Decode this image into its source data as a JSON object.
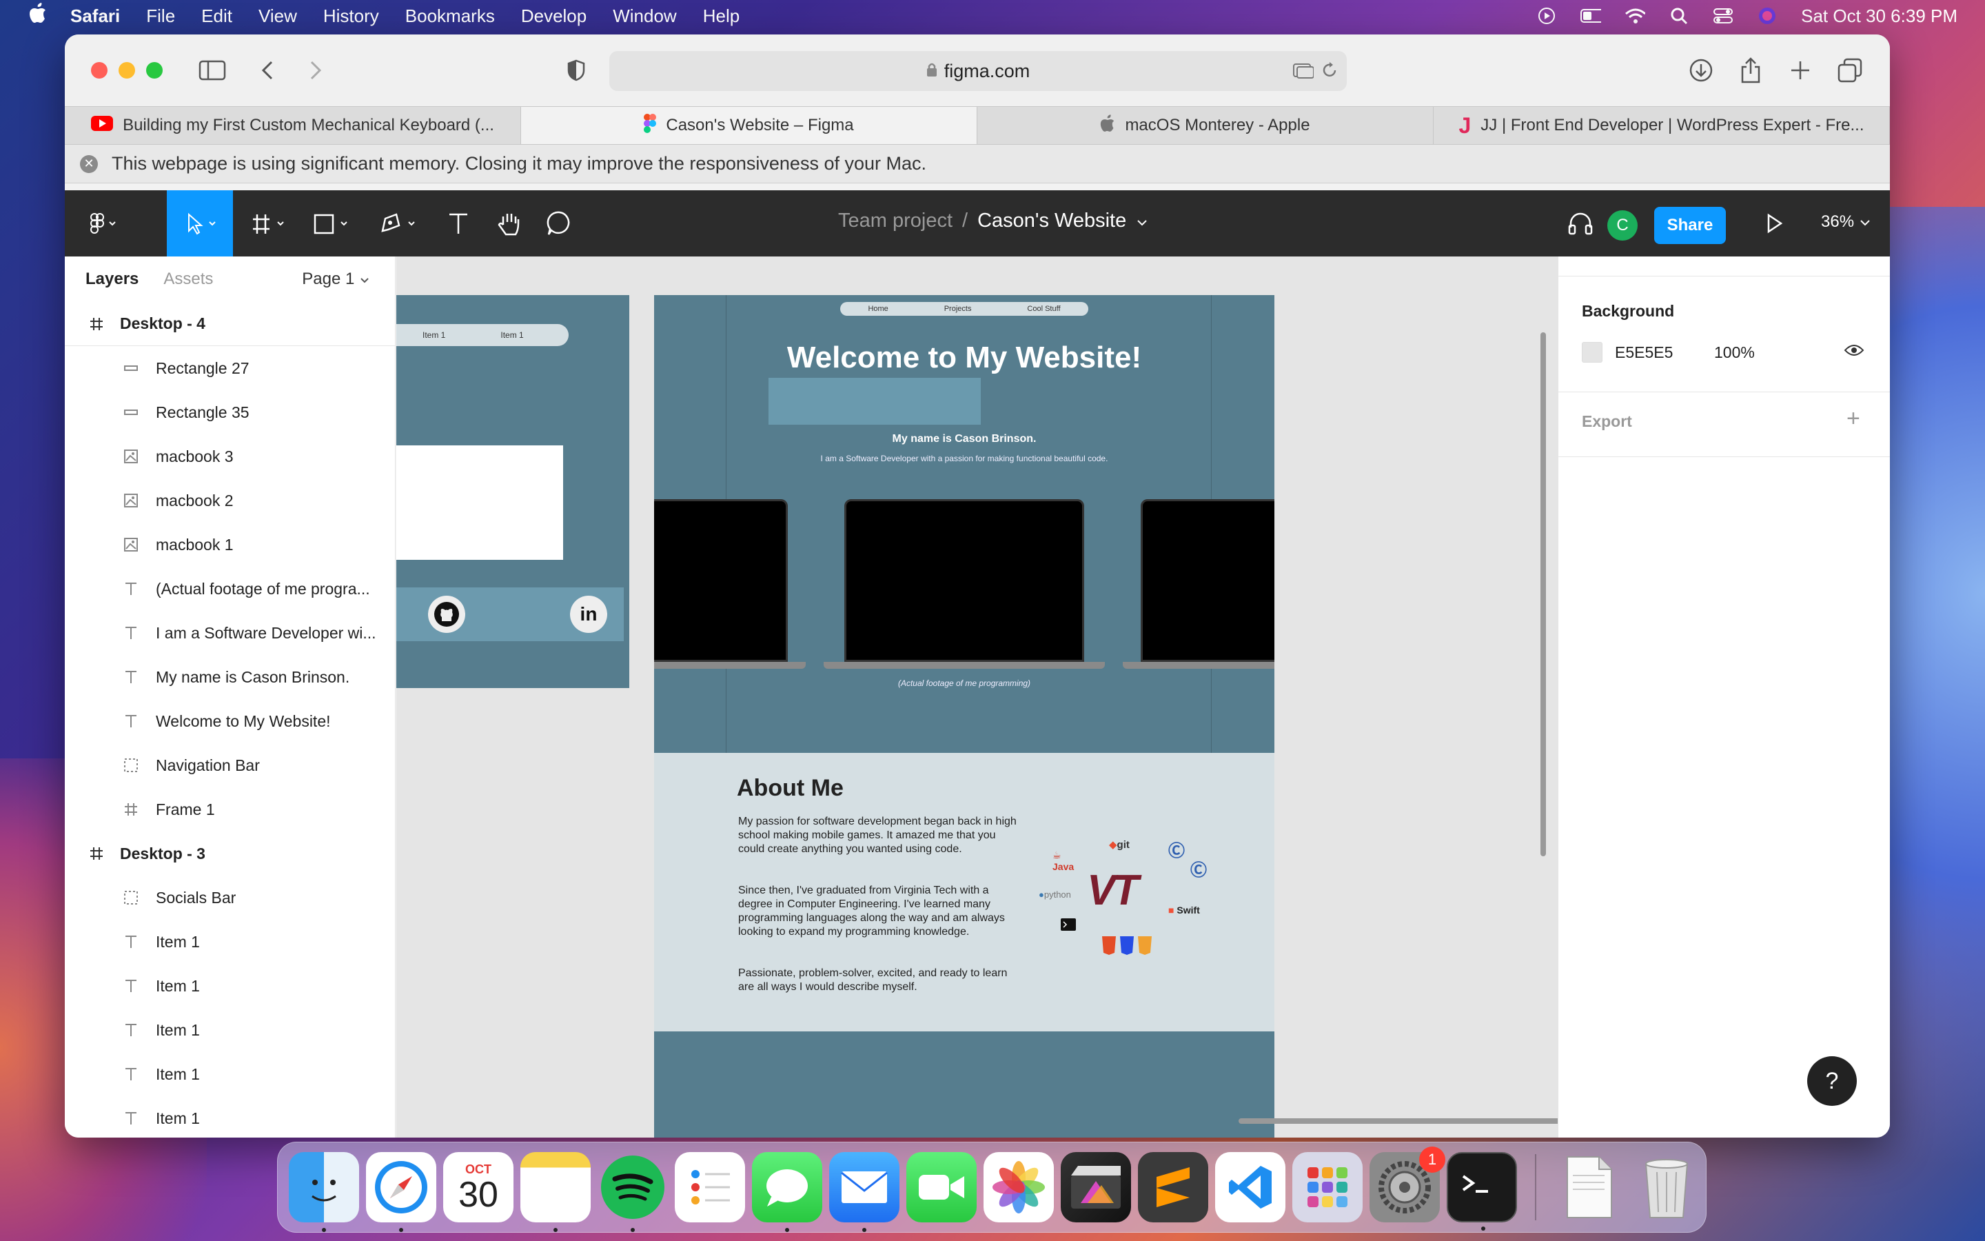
{
  "menubar": {
    "app": "Safari",
    "items": [
      "File",
      "Edit",
      "View",
      "History",
      "Bookmarks",
      "Develop",
      "Window",
      "Help"
    ],
    "datetime": "Sat Oct 30  6:39 PM"
  },
  "safari": {
    "url": "figma.com",
    "tabs": [
      {
        "label": "Building my First Custom Mechanical Keyboard (...",
        "icon": "youtube-icon"
      },
      {
        "label": "Cason's Website – Figma",
        "icon": "figma-icon"
      },
      {
        "label": "macOS Monterey - Apple",
        "icon": "apple-icon"
      },
      {
        "label": "JJ | Front End Developer | WordPress Expert - Fre...",
        "icon": "j-logo-icon"
      }
    ],
    "memory_notice": "This webpage is using significant memory. Closing it may improve the responsiveness of your Mac."
  },
  "figma": {
    "team": "Team project",
    "separator": "/",
    "file_name": "Cason's Website",
    "avatar_initial": "C",
    "share_label": "Share",
    "zoom": "36%",
    "left_panel": {
      "tabs": [
        "Layers",
        "Assets"
      ],
      "page": "Page 1",
      "layers": [
        {
          "type": "frame",
          "name": "Desktop - 4"
        },
        {
          "type": "rect",
          "name": "Rectangle 27"
        },
        {
          "type": "rect",
          "name": "Rectangle 35"
        },
        {
          "type": "image",
          "name": "macbook 3"
        },
        {
          "type": "image",
          "name": "macbook 2"
        },
        {
          "type": "image",
          "name": "macbook 1"
        },
        {
          "type": "text",
          "name": "(Actual footage of me progra..."
        },
        {
          "type": "text",
          "name": "I am a Software Developer wi..."
        },
        {
          "type": "text",
          "name": "My name is Cason Brinson."
        },
        {
          "type": "text",
          "name": "Welcome to My Website!"
        },
        {
          "type": "group",
          "name": "Navigation Bar"
        },
        {
          "type": "frame-child",
          "name": "Frame 1"
        },
        {
          "type": "frame",
          "name": "Desktop - 3"
        },
        {
          "type": "group",
          "name": "Socials Bar"
        },
        {
          "type": "text",
          "name": "Item 1"
        },
        {
          "type": "text",
          "name": "Item 1"
        },
        {
          "type": "text",
          "name": "Item 1"
        },
        {
          "type": "text",
          "name": "Item 1"
        },
        {
          "type": "text",
          "name": "Item 1"
        }
      ]
    },
    "right_panel": {
      "background_title": "Background",
      "background_hex": "E5E5E5",
      "background_opacity": "100%",
      "export_title": "Export"
    },
    "canvas": {
      "frame_a": {
        "nav_items": [
          "Item 1",
          "Item 1"
        ],
        "socials": [
          "github-icon",
          "linkedin-icon"
        ],
        "linkedin_text": "in"
      },
      "frame_b": {
        "nav_items": [
          "Home",
          "Projects",
          "Cool Stuff"
        ],
        "title": "Welcome to My Website!",
        "name_line": "My name is Cason Brinson.",
        "subtitle": "I am a Software Developer with a passion for making functional beautiful code.",
        "caption": "(Actual footage of me programming)",
        "about_title": "About Me",
        "about_paragraphs": [
          "My passion for software development began back in high school making mobile games. It amazed me that you could create anything you wanted using code.",
          "Since then, I've graduated from Virginia Tech with a degree in Computer Engineering. I've learned many programming languages along the way and am always looking to expand my programming knowledge.",
          "Passionate, problem-solver, excited, and ready to learn are all ways I would describe myself."
        ],
        "logos": {
          "java": "Java",
          "git": "git",
          "python": "python",
          "vt": "VT",
          "swift": "Swift"
        }
      }
    }
  },
  "dock": {
    "calendar_month": "OCT",
    "calendar_day": "30",
    "settings_badge": "1",
    "apps": [
      "Finder",
      "Safari",
      "Calendar",
      "Notes",
      "Spotify",
      "Reminders",
      "Messages",
      "Mail",
      "FaceTime",
      "Photos",
      "Final Cut Pro",
      "Sublime Text",
      "Visual Studio Code",
      "Launchpad",
      "System Preferences",
      "Terminal",
      "Preview",
      "Trash"
    ]
  }
}
